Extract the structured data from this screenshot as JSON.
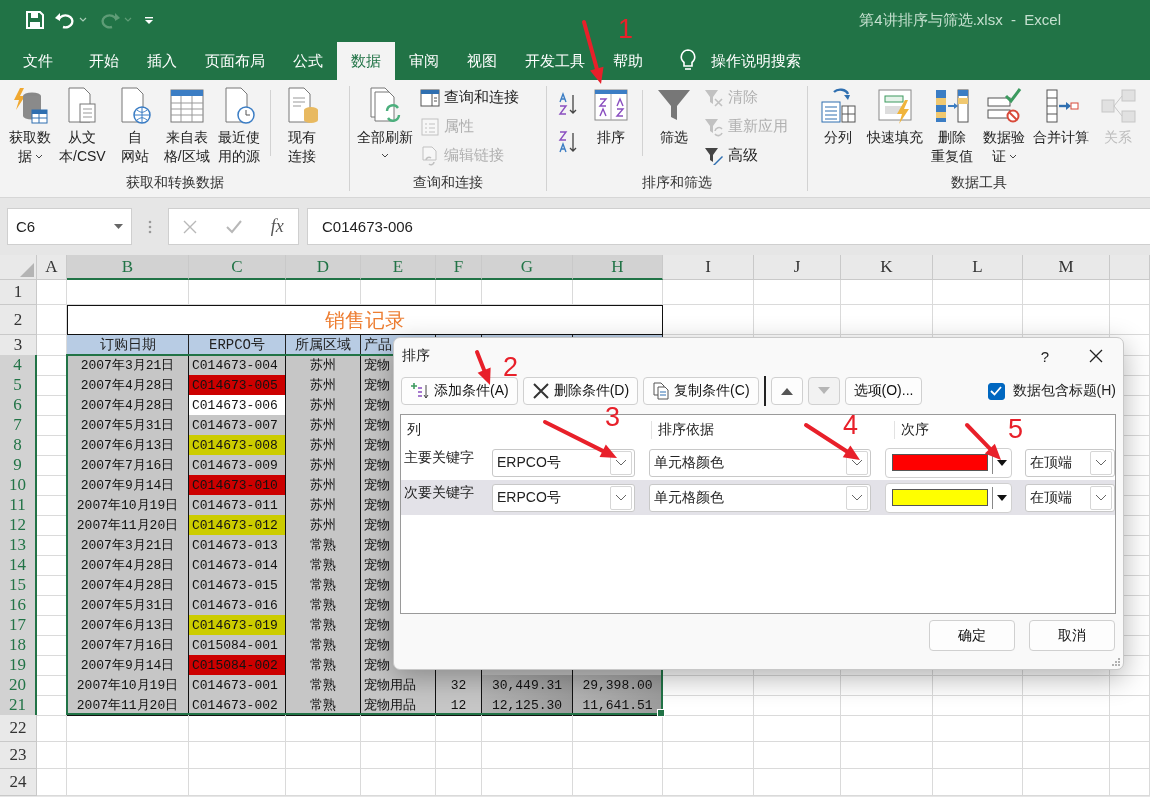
{
  "title_bar": {
    "title": "第4讲排序与筛选.xlsx  -  Excel"
  },
  "tabs": [
    {
      "label": "文件",
      "selected": false
    },
    {
      "label": "开始",
      "selected": false
    },
    {
      "label": "插入",
      "selected": false
    },
    {
      "label": "页面布局",
      "selected": false
    },
    {
      "label": "公式",
      "selected": false
    },
    {
      "label": "数据",
      "selected": true
    },
    {
      "label": "审阅",
      "selected": false
    },
    {
      "label": "视图",
      "selected": false
    },
    {
      "label": "开发工具",
      "selected": false
    },
    {
      "label": "帮助",
      "selected": false
    }
  ],
  "tell_me": "操作说明搜索",
  "ribbon": {
    "groups": [
      {
        "label": "获取和转换数据",
        "items": [
          {
            "kind": "large",
            "lines": [
              "获取数",
              "据"
            ],
            "dropdown": true,
            "disabled": false
          },
          {
            "kind": "large",
            "lines": [
              "从文",
              "本/CSV"
            ],
            "dropdown": false,
            "disabled": false
          },
          {
            "kind": "large",
            "lines": [
              "自",
              "网站"
            ],
            "dropdown": false,
            "disabled": false
          },
          {
            "kind": "large",
            "lines": [
              "来自表",
              "格/区域"
            ],
            "dropdown": false,
            "disabled": false
          },
          {
            "kind": "large",
            "lines": [
              "最近使",
              "用的源"
            ],
            "dropdown": false,
            "disabled": false
          },
          {
            "kind": "separator"
          },
          {
            "kind": "large",
            "lines": [
              "现有",
              "连接"
            ],
            "dropdown": false,
            "disabled": false
          }
        ]
      },
      {
        "label": "查询和连接",
        "items": [
          {
            "kind": "large",
            "lines": [
              "全部刷新"
            ],
            "dropdown": true,
            "disabled": false
          },
          {
            "kind": "stack",
            "items": [
              {
                "label": "查询和连接",
                "disabled": false
              },
              {
                "label": "属性",
                "disabled": true
              },
              {
                "label": "编辑链接",
                "disabled": true
              }
            ]
          }
        ]
      },
      {
        "label": "排序和筛选",
        "items": [
          {
            "kind": "sortpair"
          },
          {
            "kind": "large",
            "lines": [
              "排序"
            ],
            "dropdown": false,
            "disabled": false
          },
          {
            "kind": "separator"
          },
          {
            "kind": "large",
            "lines": [
              "筛选"
            ],
            "dropdown": false,
            "disabled": false
          },
          {
            "kind": "stack",
            "items": [
              {
                "label": "清除",
                "disabled": true
              },
              {
                "label": "重新应用",
                "disabled": true
              },
              {
                "label": "高级",
                "disabled": false
              }
            ]
          }
        ]
      },
      {
        "label": "数据工具",
        "items": [
          {
            "kind": "large",
            "lines": [
              "分列"
            ],
            "dropdown": false,
            "disabled": false
          },
          {
            "kind": "large",
            "lines": [
              "快速填充"
            ],
            "dropdown": false,
            "disabled": false
          },
          {
            "kind": "large",
            "lines": [
              "删除",
              "重复值"
            ],
            "dropdown": false,
            "disabled": false
          },
          {
            "kind": "large",
            "lines": [
              "数据验",
              "证"
            ],
            "dropdown": true,
            "disabled": false
          },
          {
            "kind": "large",
            "lines": [
              "合并计算"
            ],
            "dropdown": false,
            "disabled": false
          },
          {
            "kind": "large",
            "lines": [
              "关系"
            ],
            "dropdown": false,
            "disabled": true
          }
        ]
      }
    ]
  },
  "formula_bar": {
    "name_box": "C6",
    "fx": "fx",
    "formula": "C014673-006"
  },
  "sheet": {
    "columns": [
      {
        "label": "A",
        "selected": false
      },
      {
        "label": "B",
        "selected": true
      },
      {
        "label": "C",
        "selected": true
      },
      {
        "label": "D",
        "selected": true
      },
      {
        "label": "E",
        "selected": true
      },
      {
        "label": "F",
        "selected": true
      },
      {
        "label": "G",
        "selected": true
      },
      {
        "label": "H",
        "selected": true
      },
      {
        "label": "I",
        "selected": false
      },
      {
        "label": "J",
        "selected": false
      },
      {
        "label": "K",
        "selected": false
      },
      {
        "label": "L",
        "selected": false
      },
      {
        "label": "M",
        "selected": false
      }
    ],
    "rows": [
      {
        "number": "1",
        "kind": "empty",
        "selected": false
      },
      {
        "number": "2",
        "kind": "title",
        "selected": false,
        "title": "销售记录"
      },
      {
        "number": "3",
        "kind": "header",
        "selected": false,
        "cells": [
          "订购日期",
          "ERPCO号",
          "所属区域",
          "产品"
        ]
      },
      {
        "number": "4",
        "kind": "data",
        "selected": true,
        "date": "2007年3月21日",
        "id": {
          "text": "C014673-004",
          "active": false
        },
        "region": "苏州",
        "product": "宠物"
      },
      {
        "number": "5",
        "kind": "data",
        "selected": true,
        "date": "2007年4月28日",
        "id": {
          "text": "C014673-005",
          "active": false,
          "color": "#cc0000"
        },
        "region": "苏州",
        "product": "宠物"
      },
      {
        "number": "6",
        "kind": "data",
        "selected": true,
        "date": "2007年4月28日",
        "id": {
          "text": "C014673-006",
          "active": true
        },
        "region": "苏州",
        "product": "宠物"
      },
      {
        "number": "7",
        "kind": "data",
        "selected": true,
        "date": "2007年5月31日",
        "id": {
          "text": "C014673-007",
          "active": false
        },
        "region": "苏州",
        "product": "宠物"
      },
      {
        "number": "8",
        "kind": "data",
        "selected": true,
        "date": "2007年6月13日",
        "id": {
          "text": "C014673-008",
          "active": false,
          "color": "#cccc00"
        },
        "region": "苏州",
        "product": "宠物"
      },
      {
        "number": "9",
        "kind": "data",
        "selected": true,
        "date": "2007年7月16日",
        "id": {
          "text": "C014673-009",
          "active": false
        },
        "region": "苏州",
        "product": "宠物"
      },
      {
        "number": "10",
        "kind": "data",
        "selected": true,
        "date": "2007年9月14日",
        "id": {
          "text": "C014673-010",
          "active": false,
          "color": "#cc0000"
        },
        "region": "苏州",
        "product": "宠物"
      },
      {
        "number": "11",
        "kind": "data",
        "selected": true,
        "date": "2007年10月19日",
        "id": {
          "text": "C014673-011",
          "active": false
        },
        "region": "苏州",
        "product": "宠物"
      },
      {
        "number": "12",
        "kind": "data",
        "selected": true,
        "date": "2007年11月20日",
        "id": {
          "text": "C014673-012",
          "active": false,
          "color": "#cccc00"
        },
        "region": "苏州",
        "product": "宠物"
      },
      {
        "number": "13",
        "kind": "data",
        "selected": true,
        "date": "2007年3月21日",
        "id": {
          "text": "C014673-013",
          "active": false
        },
        "region": "常熟",
        "product": "宠物"
      },
      {
        "number": "14",
        "kind": "data",
        "selected": true,
        "date": "2007年4月28日",
        "id": {
          "text": "C014673-014",
          "active": false
        },
        "region": "常熟",
        "product": "宠物"
      },
      {
        "number": "15",
        "kind": "data",
        "selected": true,
        "date": "2007年4月28日",
        "id": {
          "text": "C014673-015",
          "active": false
        },
        "region": "常熟",
        "product": "宠物"
      },
      {
        "number": "16",
        "kind": "data",
        "selected": true,
        "date": "2007年5月31日",
        "id": {
          "text": "C014673-016",
          "active": false
        },
        "region": "常熟",
        "product": "宠物"
      },
      {
        "number": "17",
        "kind": "data",
        "selected": true,
        "date": "2007年6月13日",
        "id": {
          "text": "C014673-019",
          "active": false,
          "color": "#cccc00"
        },
        "region": "常熟",
        "product": "宠物"
      },
      {
        "number": "18",
        "kind": "data",
        "selected": true,
        "date": "2007年7月16日",
        "id": {
          "text": "C015084-001",
          "active": false
        },
        "region": "常熟",
        "product": "宠物"
      },
      {
        "number": "19",
        "kind": "data",
        "selected": true,
        "date": "2007年9月14日",
        "id": {
          "text": "C015084-002",
          "active": false,
          "color": "#cc0000"
        },
        "region": "常熟",
        "product": "宠物"
      },
      {
        "number": "20",
        "kind": "data",
        "selected": true,
        "date": "2007年10月19日",
        "id": {
          "text": "C014673-001",
          "active": false
        },
        "region": "常熟",
        "product": "宠物用品",
        "qty": "32",
        "amount_1": "30,449.31",
        "amount_2": "29,398.00"
      },
      {
        "number": "21",
        "kind": "data",
        "selected": true,
        "date": "2007年11月20日",
        "id": {
          "text": "C014673-002",
          "active": false
        },
        "region": "常熟",
        "product": "宠物用品",
        "qty": "12",
        "amount_1": "12,125.30",
        "amount_2": "11,641.51"
      },
      {
        "number": "22",
        "kind": "empty",
        "selected": false
      },
      {
        "number": "23",
        "kind": "empty",
        "selected": false
      },
      {
        "number": "24",
        "kind": "empty",
        "selected": false
      }
    ]
  },
  "dialog": {
    "title": "排序",
    "help": "?",
    "toolbar": [
      {
        "kind": "add",
        "label": "添加条件(A)",
        "disabled": false
      },
      {
        "kind": "delete",
        "label": "删除条件(D)",
        "disabled": false
      },
      {
        "kind": "copy",
        "label": "复制条件(C)",
        "disabled": false
      },
      {
        "kind": "up",
        "disabled": false
      },
      {
        "kind": "down",
        "disabled": true
      },
      {
        "kind": "options",
        "label": "选项(O)...",
        "disabled": false
      }
    ],
    "has_headers": {
      "label": "数据包含标题(H)",
      "checked": true
    },
    "headings": [
      "列",
      "排序依据",
      "次序"
    ],
    "levels": [
      {
        "label": "主要关键字",
        "column": "ERPCO号",
        "sort_on": "单元格颜色",
        "color": "#ff0000",
        "order": "在顶端",
        "selected": false
      },
      {
        "label": "次要关键字",
        "column": "ERPCO号",
        "sort_on": "单元格颜色",
        "color": "#ffff00",
        "order": "在顶端",
        "selected": true
      }
    ],
    "ok": "确定",
    "cancel": "取消"
  },
  "annotations": [
    {
      "number": "1"
    },
    {
      "number": "2"
    },
    {
      "number": "3"
    },
    {
      "number": "4"
    },
    {
      "number": "5"
    }
  ]
}
